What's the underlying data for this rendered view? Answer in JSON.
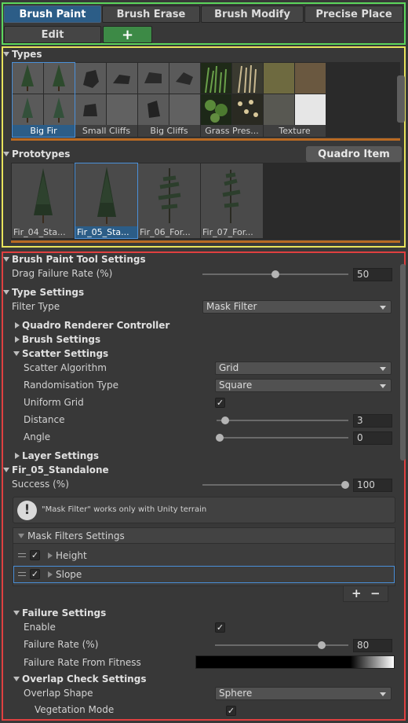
{
  "toolbar": {
    "tabs": [
      "Brush Paint",
      "Brush Erase",
      "Brush Modify",
      "Precise Place",
      "Edit"
    ],
    "add_label": "+"
  },
  "types": {
    "header": "Types",
    "items": [
      "Big Fir",
      "Small Cliffs",
      "Big Cliffs",
      "Grass Pres...",
      "Texture"
    ]
  },
  "prototypes": {
    "header": "Prototypes",
    "quadro_button": "Quadro Item",
    "items": [
      "Fir_04_Sta...",
      "Fir_05_Sta...",
      "Fir_06_For...",
      "Fir_07_For..."
    ]
  },
  "settings": {
    "brush_paint_header": "Brush Paint Tool Settings",
    "drag_failure_label": "Drag Failure Rate (%)",
    "drag_failure_value": "50",
    "drag_failure_level": 0.5,
    "type_settings_header": "Type Settings",
    "filter_type_label": "Filter Type",
    "filter_type_value": "Mask Filter",
    "quadro_renderer": "Quadro Renderer Controller",
    "brush_settings": "Brush Settings",
    "scatter_settings": "Scatter Settings",
    "scatter_algorithm_label": "Scatter Algorithm",
    "scatter_algorithm_value": "Grid",
    "randomisation_label": "Randomisation Type",
    "randomisation_value": "Square",
    "uniform_grid_label": "Uniform Grid",
    "distance_label": "Distance",
    "distance_value": "3",
    "angle_label": "Angle",
    "angle_value": "0",
    "layer_settings": "Layer Settings",
    "prototype_header": "Fir_05_Standalone",
    "success_label": "Success (%)",
    "success_value": "100",
    "help_text": "\"Mask Filter\" works only with Unity terrain",
    "mask_filters_header": "Mask Filters Settings",
    "mask_items": [
      "Height",
      "Slope"
    ],
    "plus": "+",
    "minus": "−",
    "failure_settings": "Failure Settings",
    "enable_label": "Enable",
    "failure_rate_label": "Failure Rate (%)",
    "failure_rate_value": "80",
    "failure_rate_level": 0.8,
    "failure_fitness_label": "Failure Rate From Fitness",
    "overlap_header": "Overlap Check Settings",
    "overlap_shape_label": "Overlap Shape",
    "overlap_shape_value": "Sphere",
    "vegetation_mode_label": "Vegetation Mode"
  },
  "colors": {
    "active_tab": "#2c5d87",
    "add_tab": "#3d8a46",
    "green_frame": "#5cd65c",
    "yellow_frame": "#e8e35c",
    "red_frame": "#e04040"
  }
}
